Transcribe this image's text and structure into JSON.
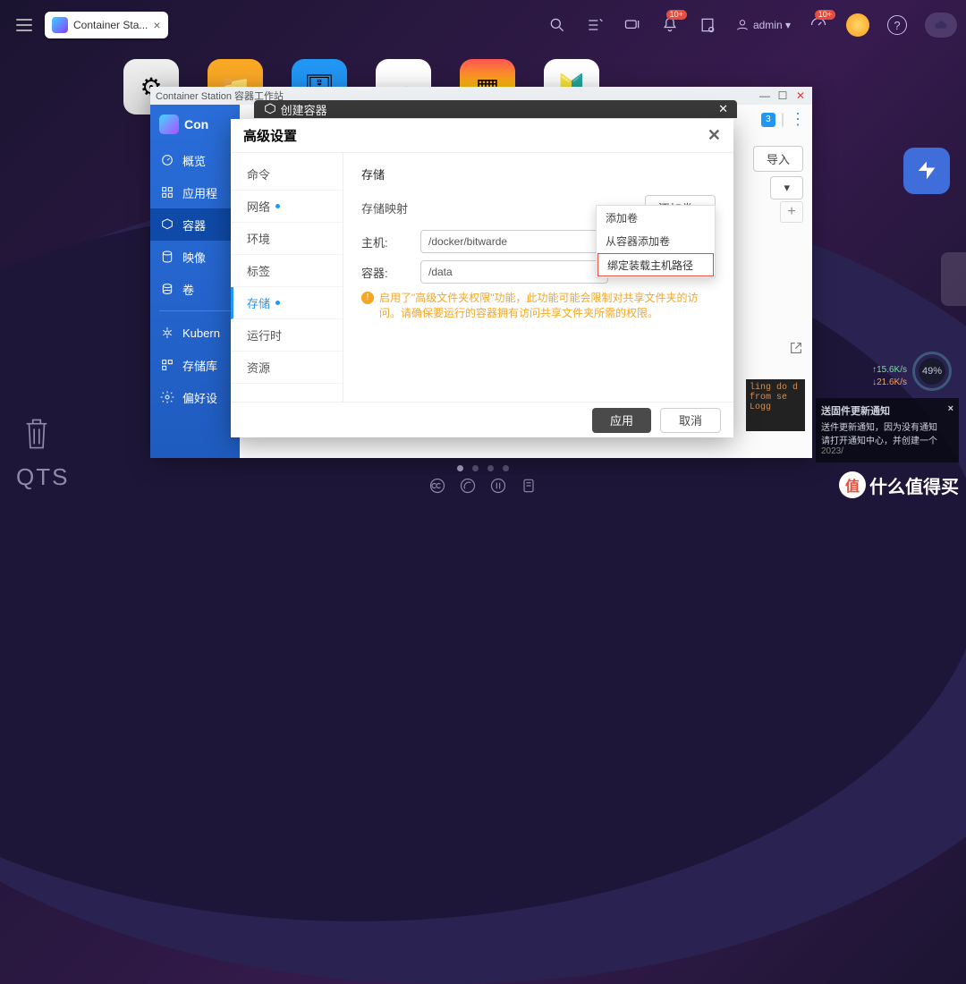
{
  "topbar": {
    "tab": {
      "label": "Container Sta...",
      "close": "×"
    },
    "notif_badge": "10+",
    "dash_badge": "10+",
    "user": "admin ▾"
  },
  "cs": {
    "title": "Container Station 容器工作站",
    "logo": "Con",
    "nav": {
      "overview": "概览",
      "apps": "应用程",
      "containers": "容器",
      "images": "映像",
      "volumes": "卷",
      "kubernetes": "Kubern",
      "storage": "存储库",
      "prefs": "偏好设"
    },
    "count": "3",
    "import": "导入",
    "caret": "▾",
    "plus": "+",
    "term": "ling do\nd from\nse Logg"
  },
  "modal_create": {
    "title": "创建容器"
  },
  "modal_adv": {
    "title": "高级设置",
    "side": {
      "cmd": "命令",
      "net": "网络",
      "env": "环境",
      "labels": "标签",
      "storage": "存储",
      "runtime": "运行时",
      "res": "资源"
    },
    "pane": {
      "heading": "存储",
      "mapping": "存储映射",
      "add_volume": "添加卷 ▴",
      "host_label": "主机:",
      "host_value": "/docker/bitwarde",
      "container_label": "容器:",
      "container_value": "/data",
      "warning": "启用了\"高级文件夹权限\"功能，此功能可能会限制对共享文件夹的访问。请确保要运行的容器拥有访问共享文件夹所需的权限。"
    },
    "dropdown": {
      "opt1": "添加卷",
      "opt2": "从容器添加卷",
      "opt3": "绑定装载主机路径"
    },
    "apply": "应用",
    "cancel": "取消"
  },
  "sys_label": "QTS",
  "gauge": "49%",
  "net": {
    "up": "↑15.6K/s",
    "down": "↓21.6K/s"
  },
  "toast": {
    "title": "送固件更新通知",
    "body": "送件更新通知，因为没有通知\n请打开通知中心，并创建一个",
    "date": "2023/",
    "x": "×"
  },
  "watermark": "什么值得买"
}
